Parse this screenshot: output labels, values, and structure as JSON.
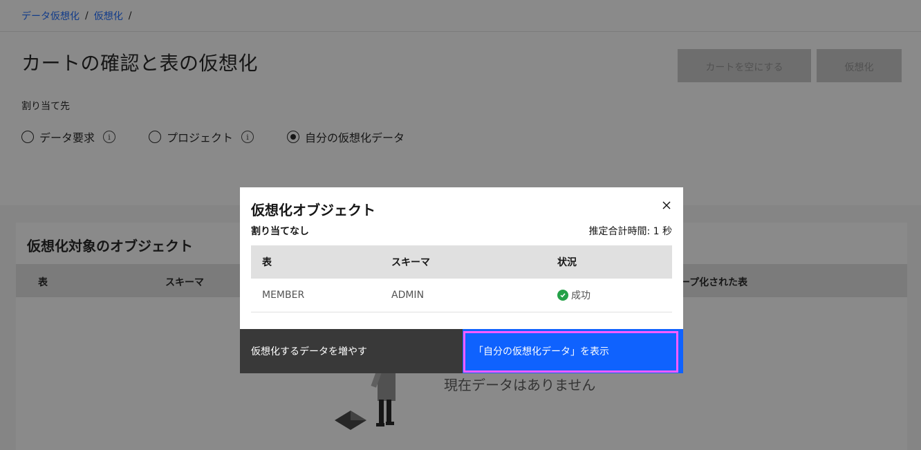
{
  "breadcrumb": {
    "items": [
      "データ仮想化",
      "仮想化"
    ],
    "separator": "/"
  },
  "page": {
    "title": "カートの確認と表の仮想化",
    "buttons": {
      "empty_cart": "カートを空にする",
      "virtualize": "仮想化"
    },
    "assign_label": "割り当て先",
    "radios": [
      {
        "label": "データ要求",
        "checked": false,
        "info": true
      },
      {
        "label": "プロジェクト",
        "checked": false,
        "info": true
      },
      {
        "label": "自分の仮想化データ",
        "checked": true,
        "info": false
      }
    ],
    "info_glyph": "i"
  },
  "panel": {
    "title": "仮想化対象のオブジェクト",
    "columns": [
      "表",
      "スキーマ",
      "ープ化された表"
    ],
    "empty_text": "現在データはありません"
  },
  "modal": {
    "title": "仮想化オブジェクト",
    "close_glyph": "×",
    "subtitle": "割り当てなし",
    "estimated_time": "推定合計時間: 1 秒",
    "table": {
      "columns": [
        "表",
        "スキーマ",
        "状況"
      ],
      "rows": [
        {
          "table": "MEMBER",
          "schema": "ADMIN",
          "status": "成功"
        }
      ]
    },
    "footer": {
      "secondary": "仮想化するデータを増やす",
      "primary": "「自分の仮想化データ」を表示"
    }
  },
  "colors": {
    "link": "#0f62fe",
    "primary_button": "#0f62fe",
    "secondary_button": "#393939",
    "success": "#24a148",
    "focus": "#ff5cff"
  }
}
